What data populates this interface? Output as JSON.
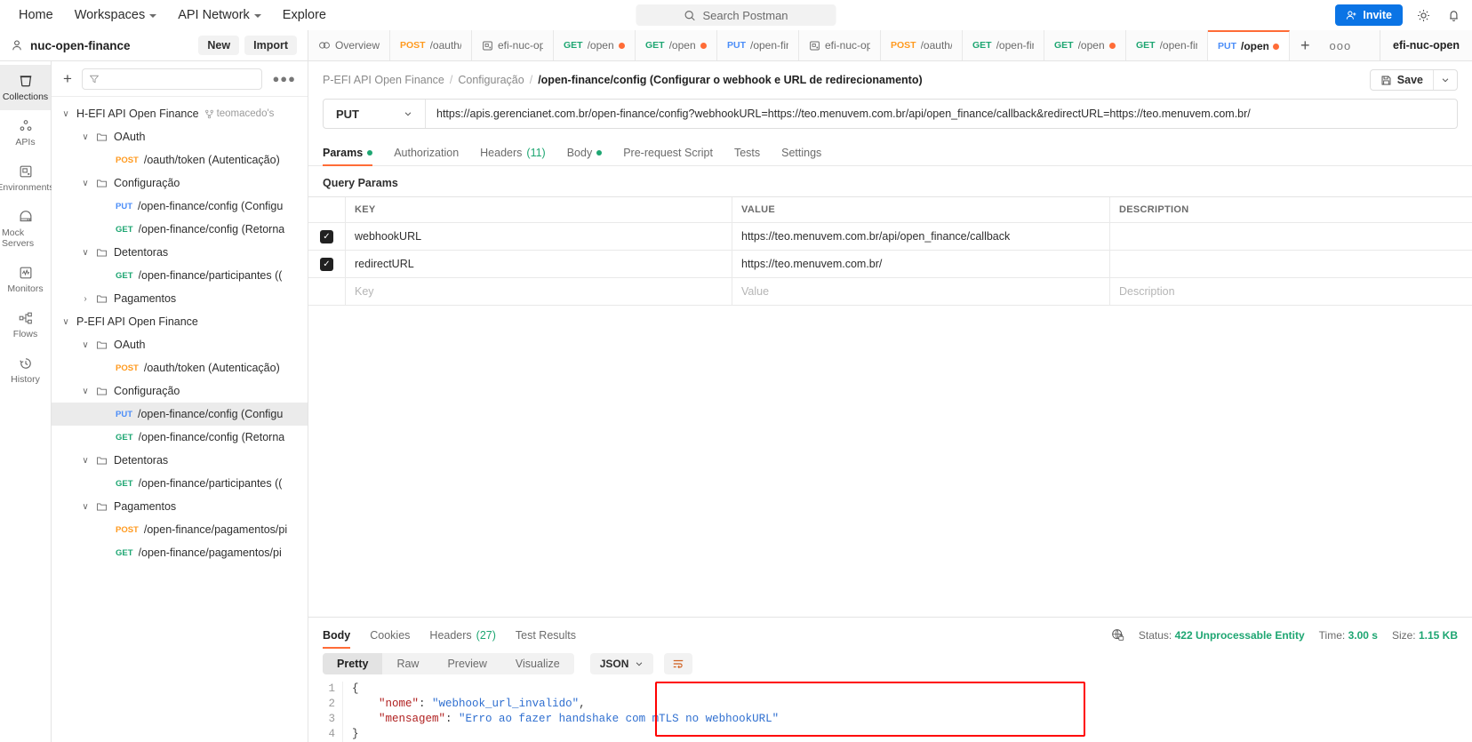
{
  "topbar": {
    "menu": [
      {
        "label": "Home",
        "caret": false
      },
      {
        "label": "Workspaces",
        "caret": true
      },
      {
        "label": "API Network",
        "caret": true
      },
      {
        "label": "Explore",
        "caret": false
      }
    ],
    "search_placeholder": "Search Postman",
    "invite_label": "Invite",
    "settings_icon": "gear-icon",
    "notifications_icon": "bell-icon"
  },
  "workspace": {
    "name": "nuc-open-finance",
    "new_label": "New",
    "import_label": "Import"
  },
  "tabs": [
    {
      "method": "",
      "label": "Overview",
      "dirty": false,
      "active": false,
      "kind": "overview"
    },
    {
      "method": "POST",
      "label": "/oauth/to",
      "dirty": false,
      "active": false,
      "kind": "request"
    },
    {
      "method": "",
      "label": "efi-nuc-op",
      "dirty": false,
      "active": false,
      "kind": "env"
    },
    {
      "method": "GET",
      "label": "/open-f",
      "dirty": true,
      "active": false,
      "kind": "request"
    },
    {
      "method": "GET",
      "label": "/open-f",
      "dirty": true,
      "active": false,
      "kind": "request"
    },
    {
      "method": "PUT",
      "label": "/open-fina",
      "dirty": false,
      "active": false,
      "kind": "request"
    },
    {
      "method": "",
      "label": "efi-nuc-op",
      "dirty": false,
      "active": false,
      "kind": "env"
    },
    {
      "method": "POST",
      "label": "/oauth/to",
      "dirty": false,
      "active": false,
      "kind": "request"
    },
    {
      "method": "GET",
      "label": "/open-fina",
      "dirty": false,
      "active": false,
      "kind": "request"
    },
    {
      "method": "GET",
      "label": "/open-f",
      "dirty": true,
      "active": false,
      "kind": "request"
    },
    {
      "method": "GET",
      "label": "/open-fina",
      "dirty": false,
      "active": false,
      "kind": "request"
    },
    {
      "method": "PUT",
      "label": "/open-f",
      "dirty": true,
      "active": true,
      "kind": "request"
    }
  ],
  "tab_actions": {
    "add": "+",
    "more": "●●●"
  },
  "environment_selector": "efi-nuc-open",
  "rail": [
    {
      "label": "Collections",
      "icon": "collections-icon",
      "active": true
    },
    {
      "label": "APIs",
      "icon": "apis-icon",
      "active": false
    },
    {
      "label": "Environments",
      "icon": "environments-icon",
      "active": false
    },
    {
      "label": "Mock Servers",
      "icon": "mock-servers-icon",
      "active": false
    },
    {
      "label": "Monitors",
      "icon": "monitors-icon",
      "active": false
    },
    {
      "label": "Flows",
      "icon": "flows-icon",
      "active": false
    },
    {
      "label": "History",
      "icon": "history-icon",
      "active": false
    }
  ],
  "sidebar": {
    "filter_placeholder": "",
    "tree": [
      {
        "depth": 0,
        "type": "collection",
        "chevron": "down",
        "name": "H-EFI API Open Finance",
        "fork": "teomacedo's",
        "selected": false
      },
      {
        "depth": 1,
        "type": "folder",
        "chevron": "down",
        "name": "OAuth",
        "selected": false
      },
      {
        "depth": 2,
        "type": "request",
        "method": "POST",
        "name": "/oauth/token (Autenticação)",
        "selected": false
      },
      {
        "depth": 1,
        "type": "folder",
        "chevron": "down",
        "name": "Configuração",
        "selected": false
      },
      {
        "depth": 2,
        "type": "request",
        "method": "PUT",
        "name": "/open-finance/config (Configu",
        "selected": false
      },
      {
        "depth": 2,
        "type": "request",
        "method": "GET",
        "name": "/open-finance/config (Retorna",
        "selected": false
      },
      {
        "depth": 1,
        "type": "folder",
        "chevron": "down",
        "name": "Detentoras",
        "selected": false
      },
      {
        "depth": 2,
        "type": "request",
        "method": "GET",
        "name": "/open-finance/participantes ((",
        "selected": false
      },
      {
        "depth": 1,
        "type": "folder",
        "chevron": "right",
        "name": "Pagamentos",
        "selected": false
      },
      {
        "depth": 0,
        "type": "collection",
        "chevron": "down",
        "name": "P-EFI API Open Finance",
        "fork": "",
        "selected": false
      },
      {
        "depth": 1,
        "type": "folder",
        "chevron": "down",
        "name": "OAuth",
        "selected": false
      },
      {
        "depth": 2,
        "type": "request",
        "method": "POST",
        "name": "/oauth/token (Autenticação)",
        "selected": false
      },
      {
        "depth": 1,
        "type": "folder",
        "chevron": "down",
        "name": "Configuração",
        "selected": false
      },
      {
        "depth": 2,
        "type": "request",
        "method": "PUT",
        "name": "/open-finance/config (Configu",
        "selected": true
      },
      {
        "depth": 2,
        "type": "request",
        "method": "GET",
        "name": "/open-finance/config (Retorna",
        "selected": false
      },
      {
        "depth": 1,
        "type": "folder",
        "chevron": "down",
        "name": "Detentoras",
        "selected": false
      },
      {
        "depth": 2,
        "type": "request",
        "method": "GET",
        "name": "/open-finance/participantes ((",
        "selected": false
      },
      {
        "depth": 1,
        "type": "folder",
        "chevron": "down",
        "name": "Pagamentos",
        "selected": false
      },
      {
        "depth": 2,
        "type": "request",
        "method": "POST",
        "name": "/open-finance/pagamentos/pi",
        "selected": false
      },
      {
        "depth": 2,
        "type": "request",
        "method": "GET",
        "name": "/open-finance/pagamentos/pi",
        "selected": false
      }
    ]
  },
  "request": {
    "breadcrumb": [
      "P-EFI API Open Finance",
      "Configuração"
    ],
    "breadcrumb_current": "/open-finance/config (Configurar o webhook e URL de redirecionamento)",
    "save_label": "Save",
    "method": "PUT",
    "url": "https://apis.gerencianet.com.br/open-finance/config?webhookURL=https://teo.menuvem.com.br/api/open_finance/callback&redirectURL=https://teo.menuvem.com.br/",
    "tabs": [
      {
        "label": "Params",
        "dot": true,
        "count": "",
        "active": true
      },
      {
        "label": "Authorization",
        "dot": false,
        "count": "",
        "active": false
      },
      {
        "label": "Headers",
        "dot": false,
        "count": "(11)",
        "active": false
      },
      {
        "label": "Body",
        "dot": true,
        "count": "",
        "active": false
      },
      {
        "label": "Pre-request Script",
        "dot": false,
        "count": "",
        "active": false
      },
      {
        "label": "Tests",
        "dot": false,
        "count": "",
        "active": false
      },
      {
        "label": "Settings",
        "dot": false,
        "count": "",
        "active": false
      }
    ],
    "query_params_title": "Query Params",
    "table_headers": {
      "key": "KEY",
      "value": "VALUE",
      "description": "DESCRIPTION"
    },
    "params": [
      {
        "checked": true,
        "key": "webhookURL",
        "value": "https://teo.menuvem.com.br/api/open_finance/callback",
        "description": ""
      },
      {
        "checked": true,
        "key": "redirectURL",
        "value": "https://teo.menuvem.com.br/",
        "description": ""
      }
    ],
    "empty_row": {
      "key": "Key",
      "value": "Value",
      "description": "Description"
    }
  },
  "response": {
    "tabs": [
      {
        "label": "Body",
        "count": "",
        "active": true
      },
      {
        "label": "Cookies",
        "count": "",
        "active": false
      },
      {
        "label": "Headers",
        "count": "(27)",
        "active": false
      },
      {
        "label": "Test Results",
        "count": "",
        "active": false
      }
    ],
    "status_label": "Status:",
    "status_value": "422 Unprocessable Entity",
    "time_label": "Time:",
    "time_value": "3.00 s",
    "size_label": "Size:",
    "size_value": "1.15 KB",
    "view_modes": [
      {
        "label": "Pretty",
        "active": true
      },
      {
        "label": "Raw",
        "active": false
      },
      {
        "label": "Preview",
        "active": false
      },
      {
        "label": "Visualize",
        "active": false
      }
    ],
    "format": "JSON",
    "wrap_icon": "wrap-lines-icon",
    "body_lines": [
      {
        "n": "1",
        "parts": [
          {
            "t": "{",
            "c": "p"
          }
        ]
      },
      {
        "n": "2",
        "parts": [
          {
            "t": "    ",
            "c": "p"
          },
          {
            "t": "\"nome\"",
            "c": "k"
          },
          {
            "t": ": ",
            "c": "p"
          },
          {
            "t": "\"webhook_url_invalido\"",
            "c": "s"
          },
          {
            "t": ",",
            "c": "p"
          }
        ]
      },
      {
        "n": "3",
        "parts": [
          {
            "t": "    ",
            "c": "p"
          },
          {
            "t": "\"mensagem\"",
            "c": "k"
          },
          {
            "t": ": ",
            "c": "p"
          },
          {
            "t": "\"Erro ao fazer handshake com mTLS no webhookURL\"",
            "c": "s"
          }
        ]
      },
      {
        "n": "4",
        "parts": [
          {
            "t": "}",
            "c": "p"
          }
        ]
      }
    ],
    "annotation_color": "#ff0000"
  }
}
